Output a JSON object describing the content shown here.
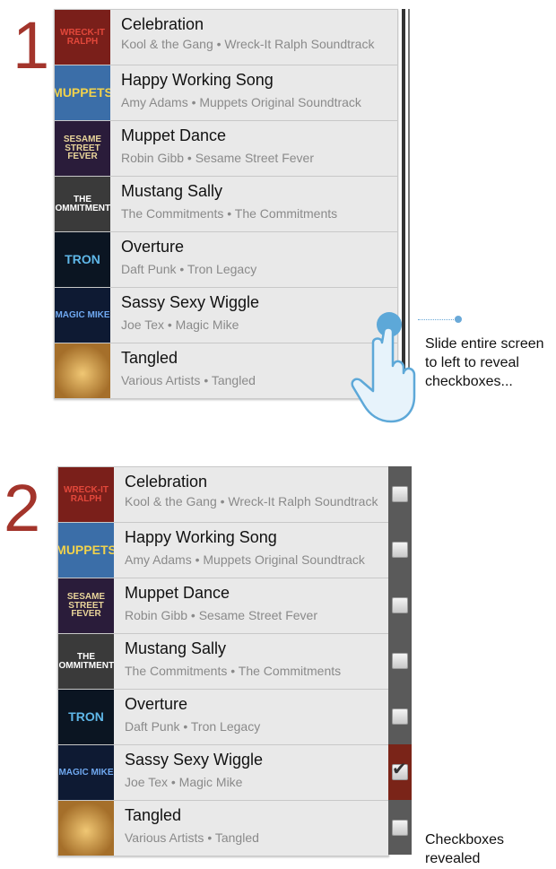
{
  "steps": [
    {
      "number": "1",
      "note": "Slide entire screen to left to reveal checkboxes..."
    },
    {
      "number": "2",
      "note": "Checkboxes revealed"
    }
  ],
  "songs": [
    {
      "title": "Celebration",
      "subtitle": "Kool & the Gang • Wreck-It Ralph Soundtrack",
      "art_text": "WRECK-IT RALPH",
      "art_bg": "#7a1f1a",
      "art_fg": "#e3483b"
    },
    {
      "title": "Happy Working Song",
      "subtitle": "Amy Adams • Muppets Original Soundtrack",
      "art_text": "MUPPETS",
      "art_bg": "#3b6ea8",
      "art_fg": "#f2d24b"
    },
    {
      "title": "Muppet Dance",
      "subtitle": "Robin Gibb • Sesame Street Fever",
      "art_text": "SESAME STREET FEVER",
      "art_bg": "#2a1c3a",
      "art_fg": "#e9d59a"
    },
    {
      "title": "Mustang Sally",
      "subtitle": "The Commitments • The Commitments",
      "art_text": "THE COMMITMENTS",
      "art_bg": "#3a3a3a",
      "art_fg": "#ffffff"
    },
    {
      "title": "Overture",
      "subtitle": "Daft Punk • Tron Legacy",
      "art_text": "TRON",
      "art_bg": "#0b1522",
      "art_fg": "#5fb7e8"
    },
    {
      "title": "Sassy Sexy Wiggle",
      "subtitle": "Joe Tex • Magic Mike",
      "art_text": "MAGIC MIKE",
      "art_bg": "#0e1a33",
      "art_fg": "#6fa8f0"
    },
    {
      "title": "Tangled",
      "subtitle": "Various Artists • Tangled",
      "art_text": "",
      "art_bg": "#a56f2a",
      "art_fg": "#f0c774"
    }
  ],
  "checkboxes": [
    false,
    false,
    false,
    false,
    false,
    true,
    false
  ],
  "colors": {
    "step_number": "#a3342b",
    "checked_cell": "#7a2418",
    "leader": "#6aa9d8",
    "hand_fill": "#e7f3fb",
    "hand_stroke": "#5da8d8"
  },
  "icons": {
    "swipe_hand": "pointing-hand-icon",
    "checkmark": "checkmark-icon"
  }
}
